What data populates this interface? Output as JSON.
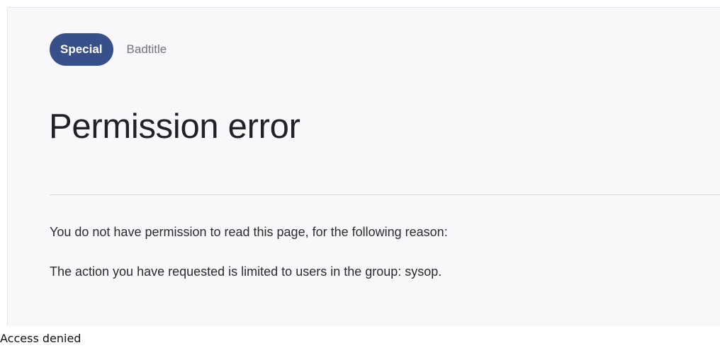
{
  "header": {
    "namespace_badge": "Special",
    "page_name": "Badtitle"
  },
  "main": {
    "title": "Permission error",
    "message": "You do not have permission to read this page, for the following reason:",
    "reason": "The action you have requested is limited to users in the group: sysop."
  },
  "status_bar": {
    "text": "Access denied"
  },
  "colors": {
    "badge_background": "#38508a",
    "page_background": "#f8f8fa",
    "heading_text": "#222226"
  }
}
